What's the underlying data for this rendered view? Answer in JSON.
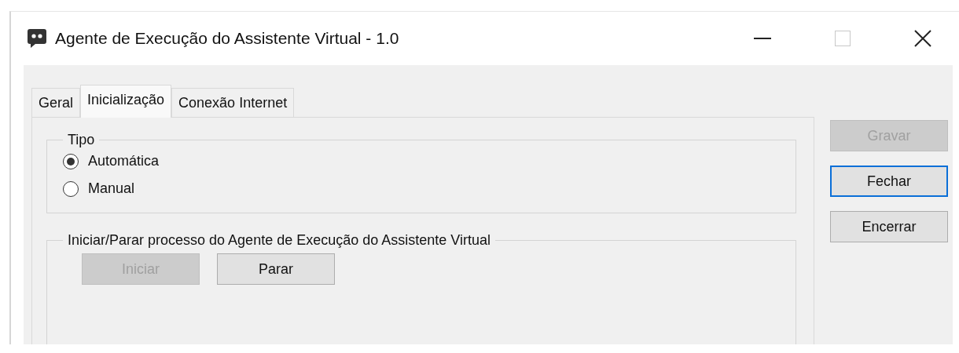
{
  "window": {
    "title": "Agente de Execução do Assistente Virtual - 1.0"
  },
  "tabs": [
    {
      "label": "Geral",
      "selected": false
    },
    {
      "label": "Inicialização",
      "selected": true
    },
    {
      "label": "Conexão Internet",
      "selected": false
    }
  ],
  "tipo_group": {
    "title": "Tipo",
    "options": [
      {
        "label": "Automática",
        "selected": true
      },
      {
        "label": "Manual",
        "selected": false
      }
    ]
  },
  "process_group": {
    "title": "Iniciar/Parar processo do Agente de Execução do Assistente Virtual",
    "buttons": [
      {
        "label": "Iniciar",
        "disabled": true
      },
      {
        "label": "Parar",
        "disabled": false
      }
    ]
  },
  "side_buttons": [
    {
      "label": "Gravar",
      "disabled": true,
      "focused": false
    },
    {
      "label": "Fechar",
      "disabled": false,
      "focused": true
    },
    {
      "label": "Encerrar",
      "disabled": false,
      "focused": false
    }
  ]
}
